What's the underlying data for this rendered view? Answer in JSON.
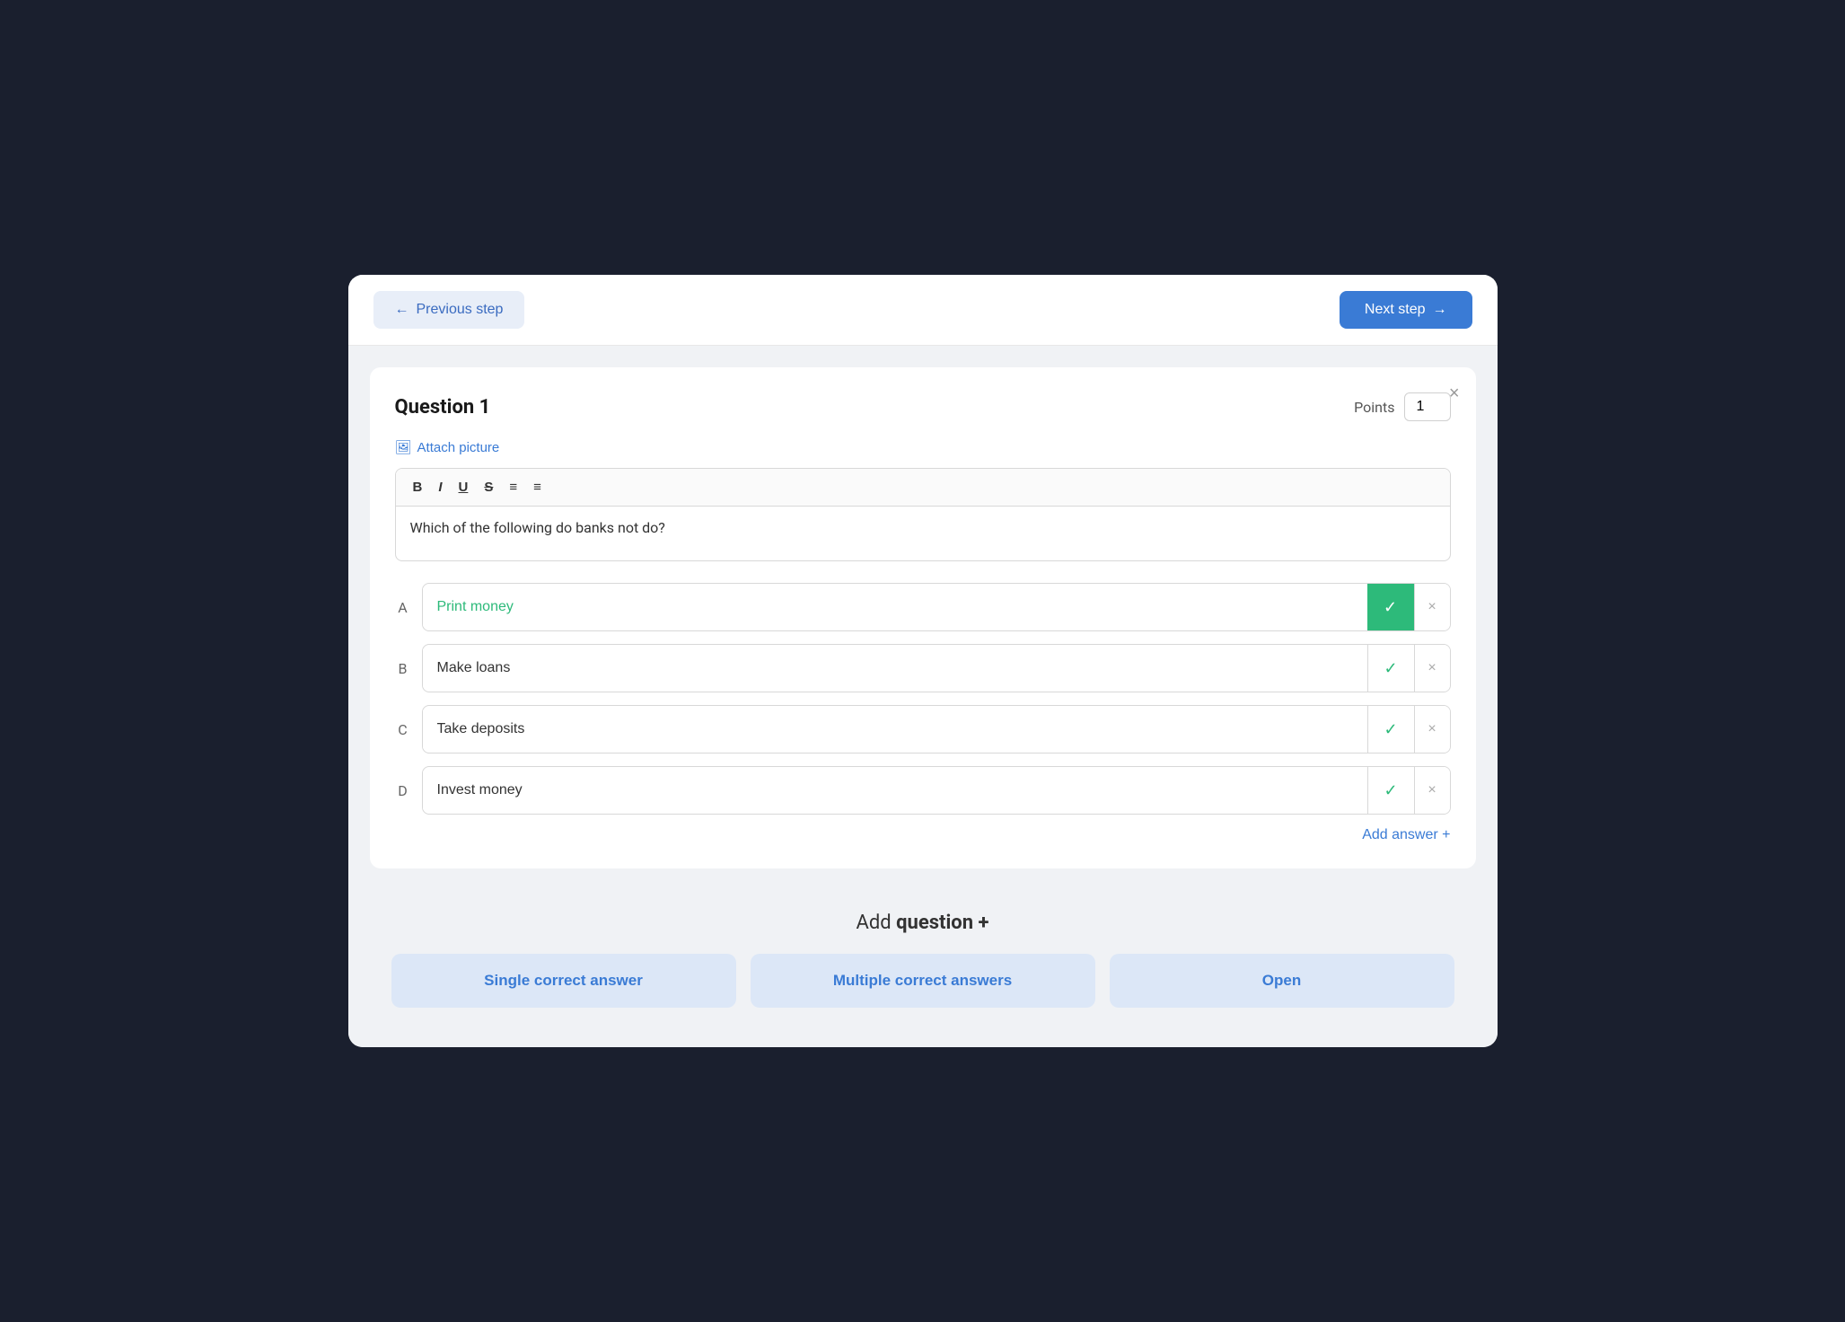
{
  "header": {
    "prev_label": "Previous step",
    "next_label": "Next step"
  },
  "question": {
    "title": "Question 1",
    "points_label": "Points",
    "points_value": "1",
    "close_icon": "×",
    "attach_label": "Attach picture",
    "editor_text": "Which of the following do banks not do?",
    "toolbar": {
      "bold": "B",
      "italic": "I",
      "underline": "U",
      "strikethrough": "S",
      "ordered_list": "≡",
      "unordered_list": "≡"
    }
  },
  "answers": [
    {
      "letter": "A",
      "text": "Print money",
      "correct": true,
      "selected": true
    },
    {
      "letter": "B",
      "text": "Make loans",
      "correct": false,
      "selected": false
    },
    {
      "letter": "C",
      "text": "Take deposits",
      "correct": false,
      "selected": false
    },
    {
      "letter": "D",
      "text": "Invest money",
      "correct": false,
      "selected": false
    }
  ],
  "add_answer": {
    "label": "Add answer +"
  },
  "add_question": {
    "prefix": "Add ",
    "bold": "question +",
    "types": [
      {
        "label": "Single correct answer"
      },
      {
        "label": "Multiple correct answers"
      },
      {
        "label": "Open"
      }
    ]
  }
}
